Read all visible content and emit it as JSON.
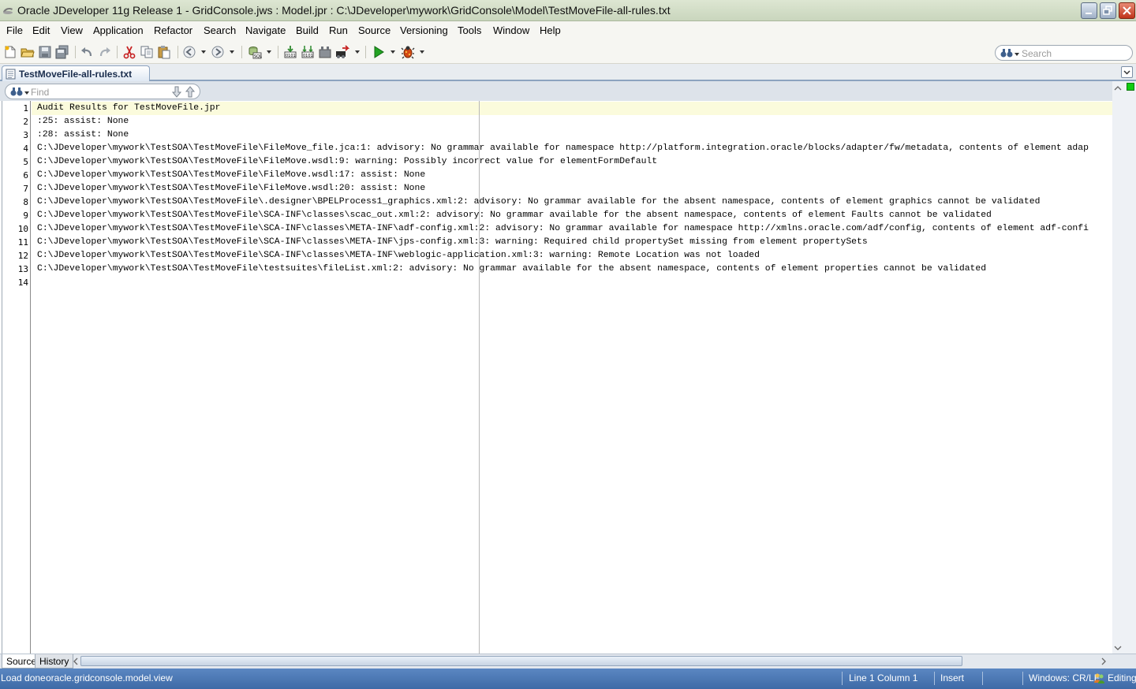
{
  "window": {
    "title": "Oracle JDeveloper 11g Release 1 - GridConsole.jws : Model.jpr : C:\\JDeveloper\\mywork\\GridConsole\\Model\\TestMoveFile-all-rules.txt"
  },
  "menu": [
    "File",
    "Edit",
    "View",
    "Application",
    "Refactor",
    "Search",
    "Navigate",
    "Build",
    "Run",
    "Source",
    "Versioning",
    "Tools",
    "Window",
    "Help"
  ],
  "toolbar": {
    "icons": [
      "new-file-icon",
      "open-icon",
      "save-icon",
      "save-all-icon",
      "undo-icon",
      "redo-icon",
      "cut-icon",
      "copy-icon",
      "paste-icon",
      "back-icon",
      "forward-icon",
      "sql-worksheet-icon",
      "make-icon",
      "rebuild-icon",
      "build-all-icon",
      "deploy-icon",
      "run-icon",
      "debug-icon"
    ],
    "search_placeholder": "Search"
  },
  "editor_tab": {
    "label": "TestMoveFile-all-rules.txt"
  },
  "find": {
    "placeholder": "Find"
  },
  "document": {
    "line_numbers": [
      "1",
      "2",
      "3",
      "4",
      "5",
      "6",
      "7",
      "8",
      "9",
      "10",
      "11",
      "12",
      "13",
      "14"
    ],
    "lines": [
      "Audit Results for TestMoveFile.jpr",
      ":25: assist: None",
      ":28: assist: None",
      "C:\\JDeveloper\\mywork\\TestSOA\\TestMoveFile\\FileMove_file.jca:1: advisory: No grammar available for namespace http://platform.integration.oracle/blocks/adapter/fw/metadata, contents of element adap",
      "C:\\JDeveloper\\mywork\\TestSOA\\TestMoveFile\\FileMove.wsdl:9: warning: Possibly incorrect value for elementFormDefault",
      "C:\\JDeveloper\\mywork\\TestSOA\\TestMoveFile\\FileMove.wsdl:17: assist: None",
      "C:\\JDeveloper\\mywork\\TestSOA\\TestMoveFile\\FileMove.wsdl:20: assist: None",
      "C:\\JDeveloper\\mywork\\TestSOA\\TestMoveFile\\.designer\\BPELProcess1_graphics.xml:2: advisory: No grammar available for the absent namespace, contents of element graphics cannot be validated",
      "C:\\JDeveloper\\mywork\\TestSOA\\TestMoveFile\\SCA-INF\\classes\\scac_out.xml:2: advisory: No grammar available for the absent namespace, contents of element Faults cannot be validated",
      "C:\\JDeveloper\\mywork\\TestSOA\\TestMoveFile\\SCA-INF\\classes\\META-INF\\adf-config.xml:2: advisory: No grammar available for namespace http://xmlns.oracle.com/adf/config, contents of element adf-confi",
      "C:\\JDeveloper\\mywork\\TestSOA\\TestMoveFile\\SCA-INF\\classes\\META-INF\\jps-config.xml:3: warning: Required child propertySet missing from element propertySets",
      "C:\\JDeveloper\\mywork\\TestSOA\\TestMoveFile\\SCA-INF\\classes\\META-INF\\weblogic-application.xml:3: warning: Remote Location was not loaded",
      "C:\\JDeveloper\\mywork\\TestSOA\\TestMoveFile\\testsuites\\fileList.xml:2: advisory: No grammar available for the absent namespace, contents of element properties cannot be validated",
      ""
    ]
  },
  "bottom_tabs": {
    "source": "Source",
    "history": "History"
  },
  "status": {
    "message": "Load done",
    "context": "oracle.gridconsole.model.view",
    "position": "Line 1 Column 1",
    "mode": "Insert",
    "line_ending": "Windows: CR/LF",
    "state": "Editing"
  },
  "colors": {
    "status_bar": "#4a76b2",
    "current_line": "#fbfbdc",
    "title_bar": "#d3dec8"
  }
}
